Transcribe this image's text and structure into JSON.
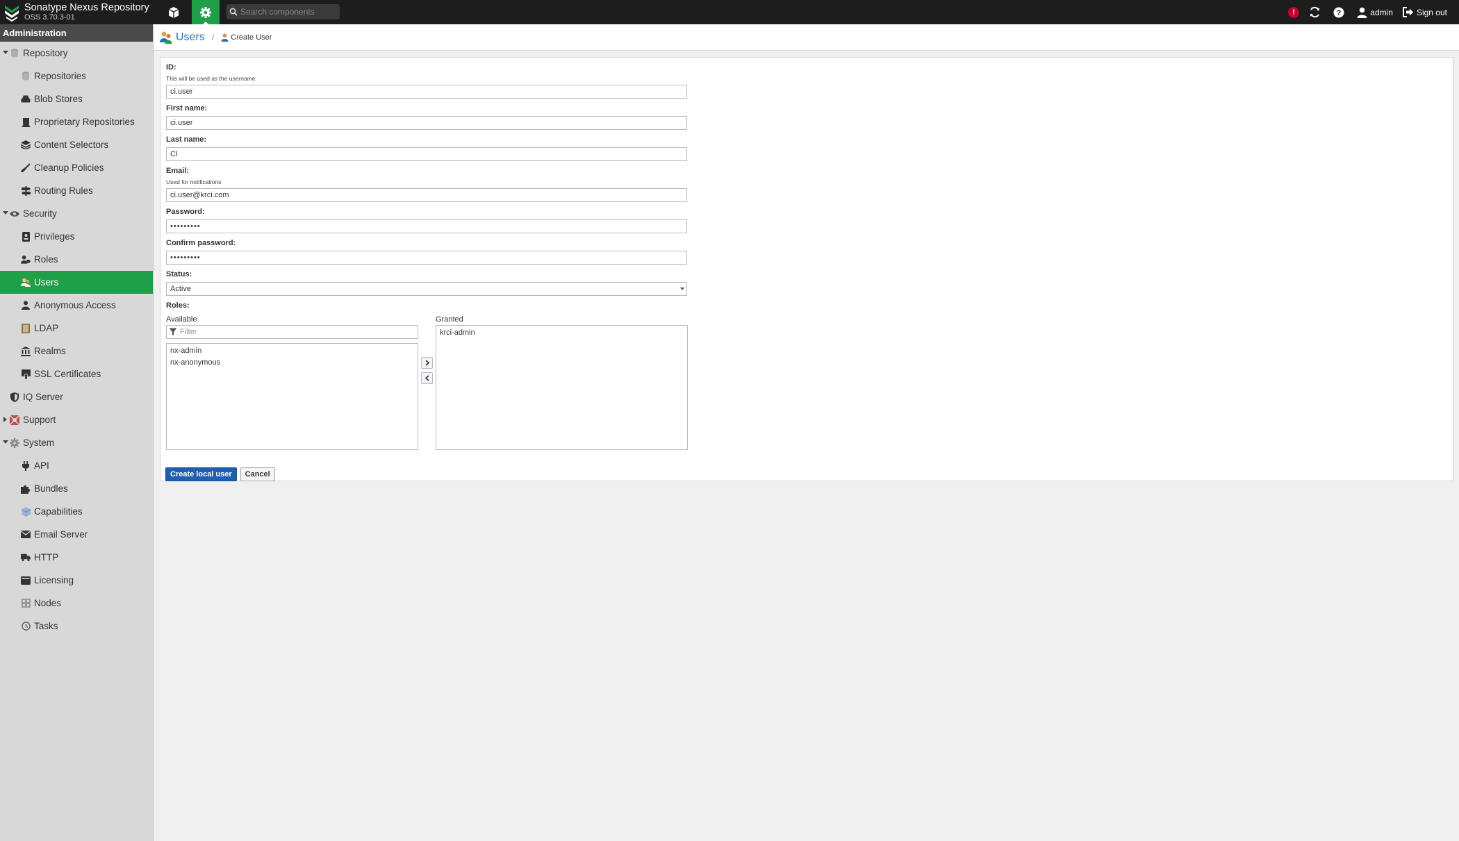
{
  "app": {
    "name": "Sonatype Nexus Repository",
    "version": "OSS 3.70.3-01"
  },
  "topbar": {
    "search_placeholder": "Search components",
    "alert_count": "!",
    "user_label": "admin",
    "signout_label": "Sign out"
  },
  "sidebar": {
    "header": "Administration",
    "items": [
      {
        "label": "Repository",
        "level": 0,
        "expanded": true,
        "icon": "database-icon"
      },
      {
        "label": "Repositories",
        "level": 1,
        "icon": "database-icon"
      },
      {
        "label": "Blob Stores",
        "level": 1,
        "icon": "hdd-icon"
      },
      {
        "label": "Proprietary Repositories",
        "level": 1,
        "icon": "user-secret-icon"
      },
      {
        "label": "Content Selectors",
        "level": 1,
        "icon": "layers-icon"
      },
      {
        "label": "Cleanup Policies",
        "level": 1,
        "icon": "broom-icon"
      },
      {
        "label": "Routing Rules",
        "level": 1,
        "icon": "signpost-icon"
      },
      {
        "label": "Security",
        "level": 0,
        "expanded": true,
        "icon": "eye-icon"
      },
      {
        "label": "Privileges",
        "level": 1,
        "icon": "id-badge-icon"
      },
      {
        "label": "Roles",
        "level": 1,
        "icon": "user-tag-icon"
      },
      {
        "label": "Users",
        "level": 1,
        "icon": "users-icon",
        "active": true
      },
      {
        "label": "Anonymous Access",
        "level": 1,
        "icon": "user-icon"
      },
      {
        "label": "LDAP",
        "level": 1,
        "icon": "book-icon"
      },
      {
        "label": "Realms",
        "level": 1,
        "icon": "bank-icon"
      },
      {
        "label": "SSL Certificates",
        "level": 1,
        "icon": "certificate-icon"
      },
      {
        "label": "IQ Server",
        "level": 0,
        "icon": "shield-icon"
      },
      {
        "label": "Support",
        "level": 0,
        "collapsed": true,
        "icon": "lifebuoy-icon"
      },
      {
        "label": "System",
        "level": 0,
        "expanded": true,
        "icon": "cog-icon"
      },
      {
        "label": "API",
        "level": 1,
        "icon": "plug-icon"
      },
      {
        "label": "Bundles",
        "level": 1,
        "icon": "puzzle-icon"
      },
      {
        "label": "Capabilities",
        "level": 1,
        "icon": "package-icon"
      },
      {
        "label": "Email Server",
        "level": 1,
        "icon": "envelope-icon"
      },
      {
        "label": "HTTP",
        "level": 1,
        "icon": "truck-icon"
      },
      {
        "label": "Licensing",
        "level": 1,
        "icon": "wallet-icon"
      },
      {
        "label": "Nodes",
        "level": 1,
        "icon": "server-icon"
      },
      {
        "label": "Tasks",
        "level": 1,
        "icon": "clock-icon"
      }
    ]
  },
  "breadcrumb": {
    "title": "Users",
    "sep": "/",
    "current": "Create User"
  },
  "form": {
    "id_label": "ID:",
    "id_help": "This will be used as the username",
    "id_value": "ci.user",
    "first_label": "First name:",
    "first_value": "ci.user",
    "last_label": "Last name:",
    "last_value": "CI",
    "email_label": "Email:",
    "email_help": "Used for notifications",
    "email_value": "ci.user@krci.com",
    "password_label": "Password:",
    "password_value": "•••••••••",
    "confirm_label": "Confirm password:",
    "confirm_value": "•••••••••",
    "status_label": "Status:",
    "status_value": "Active",
    "roles_label": "Roles:",
    "available_label": "Available",
    "granted_label": "Granted",
    "filter_placeholder": "Filter",
    "available": [
      "nx-admin",
      "nx-anonymous"
    ],
    "granted": [
      "krci-admin"
    ],
    "create_button": "Create local user",
    "cancel_button": "Cancel"
  },
  "colors": {
    "accent": "#1e9f48",
    "link": "#2470b3",
    "primary_button": "#1f5fb0",
    "topbar": "#1d1d1d"
  }
}
